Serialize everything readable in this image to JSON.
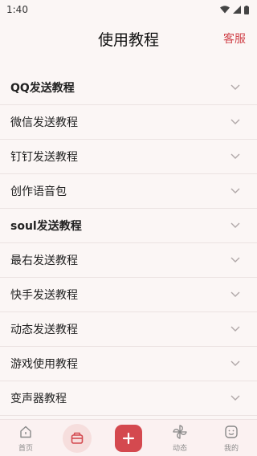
{
  "status": {
    "time": "1:40"
  },
  "header": {
    "title": "使用教程",
    "service": "客服"
  },
  "list": [
    {
      "label": "QQ发送教程"
    },
    {
      "label": "微信发送教程"
    },
    {
      "label": "钉钉发送教程"
    },
    {
      "label": "创作语音包"
    },
    {
      "label": "soul发送教程"
    },
    {
      "label": "最右发送教程"
    },
    {
      "label": "快手发送教程"
    },
    {
      "label": "动态发送教程"
    },
    {
      "label": "游戏使用教程"
    },
    {
      "label": "变声器教程"
    }
  ],
  "tabbar": {
    "home": "首页",
    "dynamic": "动态",
    "mine": "我的"
  },
  "colors": {
    "accent": "#d4494f",
    "background": "#fbf6f5"
  }
}
